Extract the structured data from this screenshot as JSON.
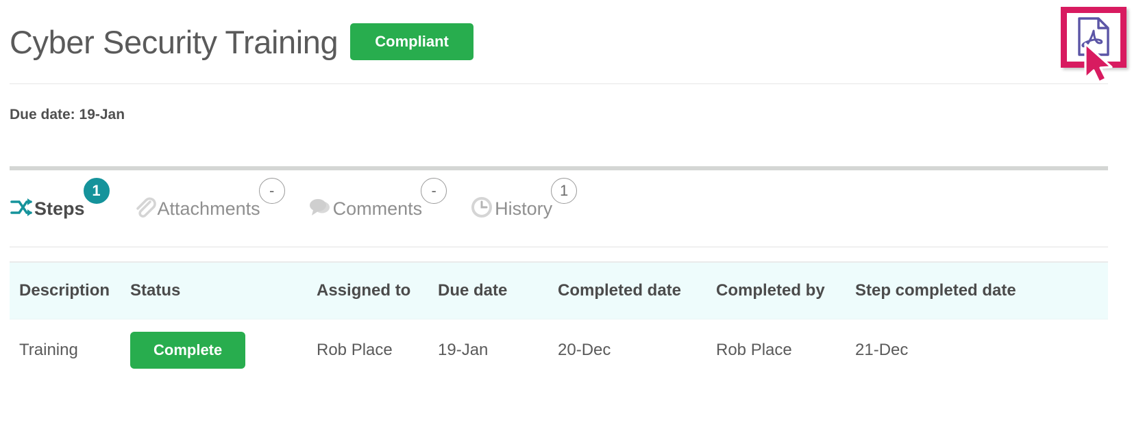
{
  "header": {
    "title": "Cyber Security Training",
    "status_label": "Compliant",
    "status_color": "#28ad4e",
    "export_icon": "pdf-file-icon",
    "export_highlight_color": "#d81b60",
    "cursor_icon": "mouse-pointer-icon"
  },
  "meta": {
    "due_date_text": "Due date: 19-Jan"
  },
  "tabs": [
    {
      "label": "Steps",
      "badge": "1",
      "icon": "shuffle-arrows-icon",
      "active": true
    },
    {
      "label": "Attachments",
      "badge": "-",
      "icon": "paperclip-icon",
      "active": false
    },
    {
      "label": "Comments",
      "badge": "-",
      "icon": "speech-bubbles-icon",
      "active": false
    },
    {
      "label": "History",
      "badge": "1",
      "icon": "clock-icon",
      "active": false
    }
  ],
  "table": {
    "columns": [
      "Description",
      "Status",
      "Assigned to",
      "Due date",
      "Completed date",
      "Completed by",
      "Step completed date"
    ],
    "rows": [
      {
        "description": "Training",
        "status": "Complete",
        "status_color": "#28ad4e",
        "assigned_to": "Rob Place",
        "due_date": "19-Jan",
        "completed_date": "20-Dec",
        "completed_by": "Rob Place",
        "step_completed_date": "21-Dec"
      }
    ]
  }
}
